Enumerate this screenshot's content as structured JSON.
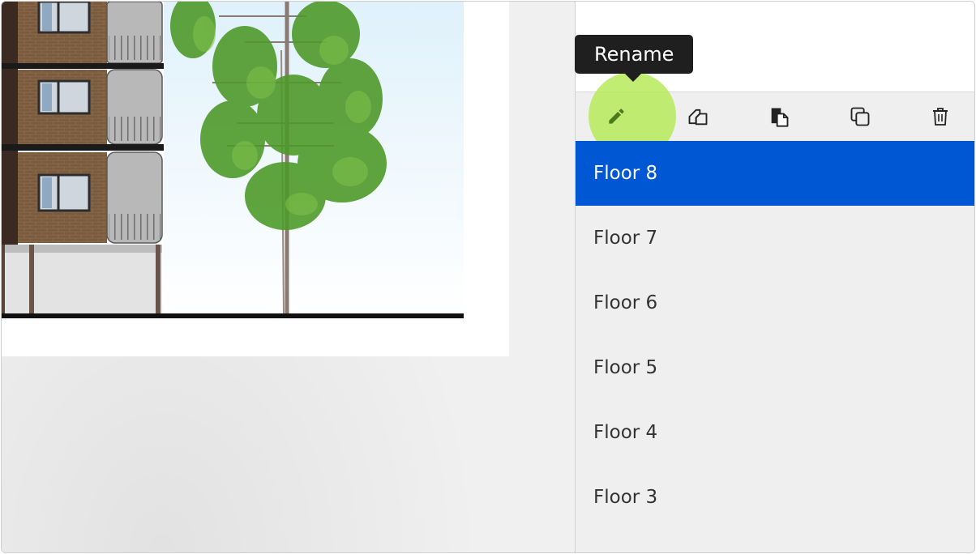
{
  "tooltip": {
    "text": "Rename"
  },
  "toolbar": {
    "buttons": [
      {
        "id": "rename",
        "icon": "pencil-icon"
      },
      {
        "id": "copy",
        "icon": "copy-icon"
      },
      {
        "id": "paste",
        "icon": "paste-icon"
      },
      {
        "id": "duplicate",
        "icon": "duplicate-icon"
      },
      {
        "id": "delete",
        "icon": "trash-icon"
      }
    ]
  },
  "floors": {
    "selected": "Floor 8",
    "items": [
      "Floor 8",
      "Floor 7",
      "Floor 6",
      "Floor 5",
      "Floor 4",
      "Floor 3"
    ]
  },
  "colors": {
    "selection": "#0057d4",
    "highlight": "#b6ea5a",
    "tooltip_bg": "#1f1f1f"
  }
}
